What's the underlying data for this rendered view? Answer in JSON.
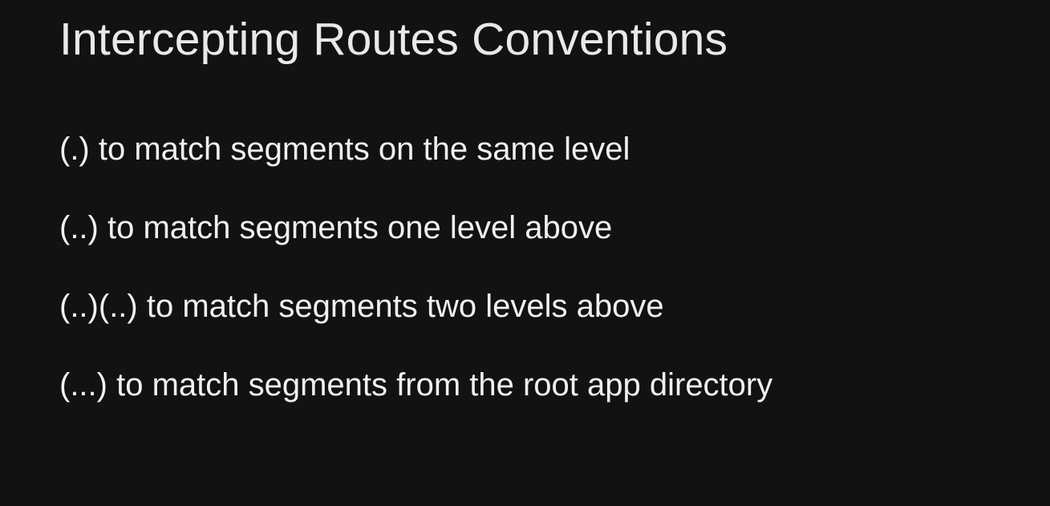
{
  "slide": {
    "title": "Intercepting Routes Conventions",
    "items": [
      {
        "text": "(.) to match segments on the same level"
      },
      {
        "text": "(..) to match segments one level above"
      },
      {
        "text": "(..)(..) to match segments two levels above"
      },
      {
        "text": "(...) to match segments from the root app directory"
      }
    ]
  },
  "colors": {
    "background": "#121212",
    "text": "#ececec"
  }
}
